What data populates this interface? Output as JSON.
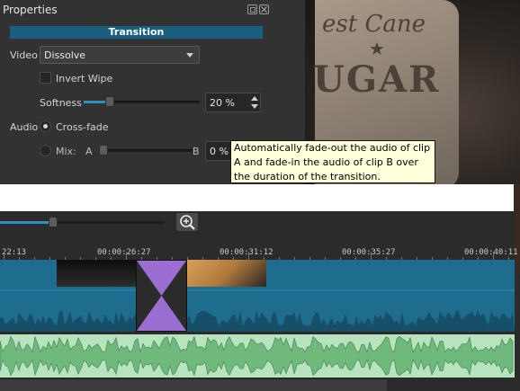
{
  "properties": {
    "title": "Properties",
    "header": "Transition",
    "video_label": "Video",
    "video_value": "Dissolve",
    "invert_label": "Invert Wipe",
    "softness_label": "Softness",
    "softness_value": "20 %",
    "softness_level": 0.2,
    "audio_label": "Audio",
    "crossfade_label": "Cross-fade",
    "mix_label": "Mix:",
    "mix_a": "A",
    "mix_b": "B",
    "mix_value": "0 %",
    "mix_level": 0.0
  },
  "tooltip": {
    "text": "Automatically fade-out the audio of clip A and fade-in the audio of clip B over the duration of the transition."
  },
  "preview": {
    "line1": "est Cane",
    "line2": "UGAR"
  },
  "timeline": {
    "zoom_level": 0.32,
    "ruler": [
      "22:13",
      "00:00:26:27",
      "00:00:31:12",
      "00:00:35:27",
      "00:00:40:11"
    ]
  },
  "colors": {
    "accent": "#2d8fc2",
    "header_bar": "#1a5e80",
    "video_track": "#1e6d8e",
    "audio_track": "#b8e3bf",
    "transition": "#9b6fd1",
    "tooltip_bg": "#ffffdc"
  },
  "icons": {
    "float": "float-icon",
    "close": "close-icon",
    "dropdown": "chevron-down-icon",
    "zoom": "zoom-in-icon"
  }
}
